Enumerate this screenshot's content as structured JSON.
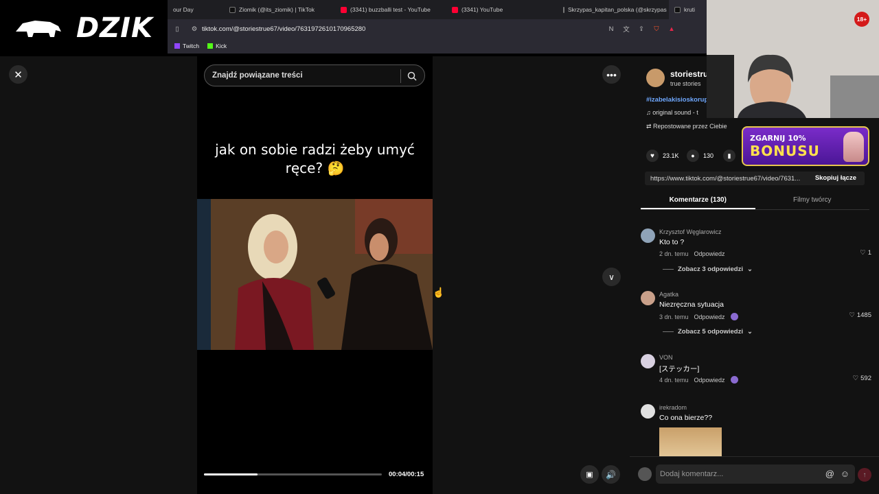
{
  "overlay": {
    "logo": "DZIK",
    "age_badge": "18+",
    "bonus_top": "ZGARNIJ 10%",
    "bonus_main": "BONUSU"
  },
  "browser": {
    "tabs": [
      {
        "label": "our Day",
        "icon": "none"
      },
      {
        "label": "Ziomik (@its_ziomik) | TikTok",
        "icon": "tiktok-icon"
      },
      {
        "label": "(3341) buzzballi test - YouTube",
        "icon": "youtube-icon"
      },
      {
        "label": "(3341) YouTube",
        "icon": "youtube-icon"
      },
      {
        "label": "Skrzypas_kapitan_polska (@skrzypas",
        "icon": "tiktok-icon"
      },
      {
        "label": "kruti",
        "icon": "tiktok-icon"
      }
    ],
    "url": "tiktok.com/@storiestrue67/video/7631972610170965280",
    "bookmarks": [
      {
        "label": "Twitch",
        "icon": "twitch-icon"
      },
      {
        "label": "Kick",
        "icon": "kick-icon"
      }
    ]
  },
  "video": {
    "search_placeholder": "Znajdź powiązane treści",
    "caption_line1": "jak on sobie radzi żeby umyć",
    "caption_line2": "ręce? 🤔",
    "time": "00:04/00:15",
    "progress": 0.3
  },
  "panel": {
    "author_name": "storiestru",
    "author_sub": "true stories",
    "hashtag": "#izabelakisioskorup",
    "sound": "original sound - t",
    "reposted": "Repostowane przez Ciebie",
    "likes": "23.1K",
    "comments": "130",
    "share_url": "https://www.tiktok.com/@storiestrue67/video/7631...",
    "copy_link": "Skopiuj łącze",
    "tab_comments": "Komentarze (130)",
    "tab_creator": "Filmy twórcy",
    "comment_placeholder": "Dodaj komentarz..."
  },
  "comments": [
    {
      "name": "Krzysztof Węglarowicz",
      "text": "Kto to ?",
      "time": "2 dn. temu",
      "reply": "Odpowiedz",
      "likes": "1",
      "replies": "Zobacz 3 odpowiedzi"
    },
    {
      "name": "Agatka",
      "text": "Niezręczna sytuacja",
      "time": "3 dn. temu",
      "reply": "Odpowiedz",
      "likes": "1485",
      "replies": "Zobacz 5 odpowiedzi"
    },
    {
      "name": "VON",
      "text": "[ステッカー]",
      "time": "4 dn. temu",
      "reply": "Odpowiedz",
      "likes": "592"
    },
    {
      "name": "irekradom",
      "text": "Co ona bierze??"
    }
  ],
  "colors": {
    "accent_red": "#fe2c55",
    "bonus_purple": "#6a22b8",
    "bonus_yellow": "#ffe14d"
  }
}
